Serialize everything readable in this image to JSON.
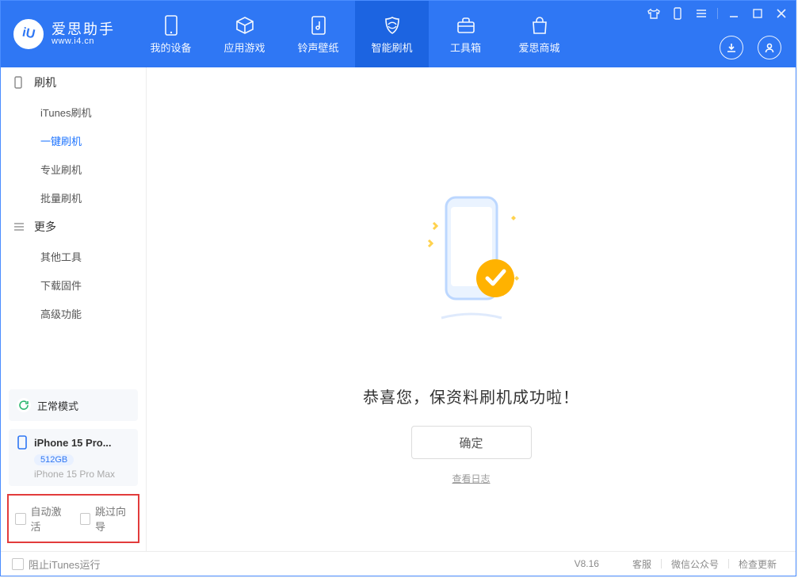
{
  "brand": {
    "name": "爱思助手",
    "url": "www.i4.cn",
    "logo_text": "iU"
  },
  "top_tabs": [
    {
      "icon": "device",
      "label": "我的设备"
    },
    {
      "icon": "cube",
      "label": "应用游戏"
    },
    {
      "icon": "music",
      "label": "铃声壁纸"
    },
    {
      "icon": "shield",
      "label": "智能刷机"
    },
    {
      "icon": "toolbox",
      "label": "工具箱"
    },
    {
      "icon": "store",
      "label": "爱思商城"
    }
  ],
  "active_tab_index": 3,
  "sidebar": {
    "groups": [
      {
        "title": "刷机",
        "icon": "phone",
        "items": [
          "iTunes刷机",
          "一键刷机",
          "专业刷机",
          "批量刷机"
        ],
        "active_index": 1
      },
      {
        "title": "更多",
        "icon": "list",
        "items": [
          "其他工具",
          "下载固件",
          "高级功能"
        ],
        "active_index": -1
      }
    ],
    "mode_status": "正常模式",
    "device": {
      "name": "iPhone 15 Pro...",
      "capacity": "512GB",
      "full": "iPhone 15 Pro Max"
    },
    "options": {
      "auto_activate": "自动激活",
      "skip_wizard": "跳过向导"
    }
  },
  "main": {
    "success_text": "恭喜您，保资料刷机成功啦！",
    "ok_button": "确定",
    "view_log": "查看日志"
  },
  "footer": {
    "block_itunes": "阻止iTunes运行",
    "version": "V8.16",
    "links": [
      "客服",
      "微信公众号",
      "检查更新"
    ]
  }
}
